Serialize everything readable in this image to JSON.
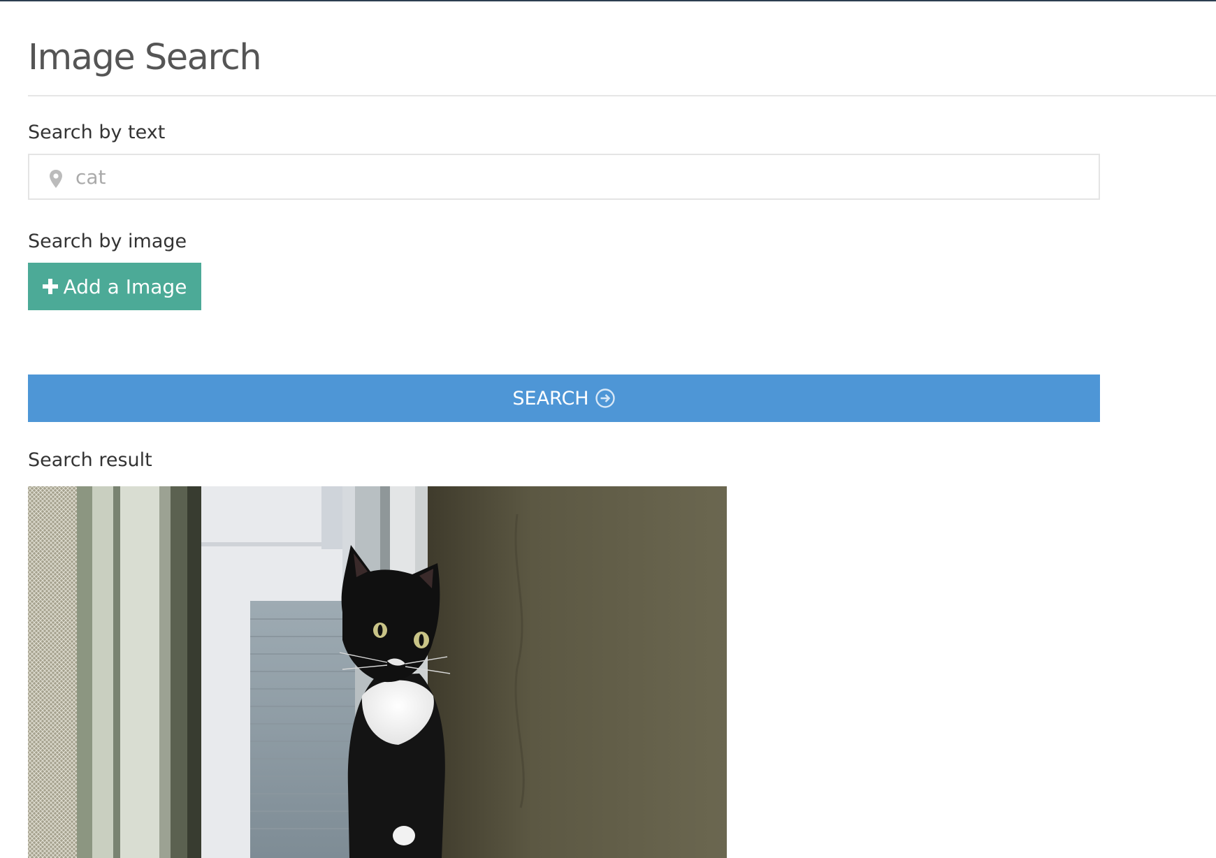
{
  "page": {
    "title": "Image Search"
  },
  "text_search": {
    "label": "Search by text",
    "value": "cat",
    "icon": "map-marker-icon"
  },
  "image_search": {
    "label": "Search by image",
    "button_label": "Add a Image",
    "button_icon": "plus-icon"
  },
  "search_button": {
    "label": "SEARCH",
    "icon": "arrow-circle-right-icon"
  },
  "results": {
    "label": "Search result",
    "items": [
      {
        "description_icon": "black-and-white-cat-photo"
      }
    ]
  },
  "colors": {
    "add_button": "#4caa97",
    "search_button": "#4e96d6",
    "top_bar": "#2c3e50"
  }
}
